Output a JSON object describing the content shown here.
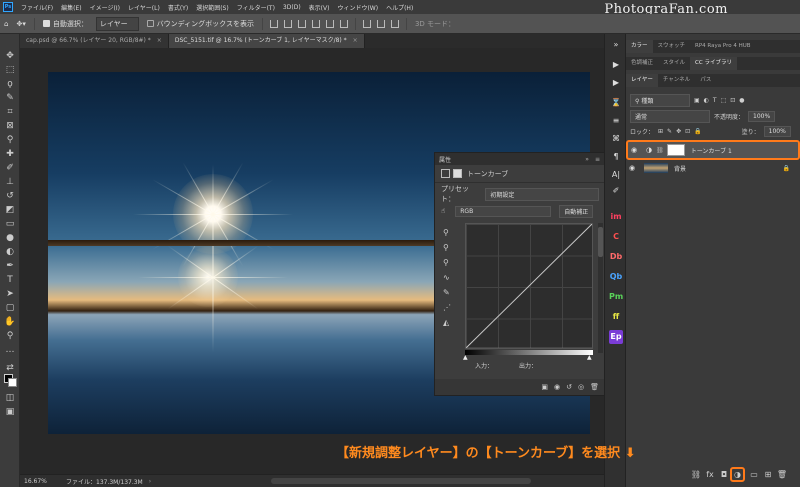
{
  "menubar": {
    "items": [
      "ファイル(F)",
      "編集(E)",
      "イメージ(I)",
      "レイヤー(L)",
      "書式(Y)",
      "選択範囲(S)",
      "フィルター(T)",
      "3D(D)",
      "表示(V)",
      "ウィンドウ(W)",
      "ヘルプ(H)"
    ],
    "logo_letters": "Ps"
  },
  "watermark": "PhotograFan.com",
  "options": {
    "auto_select_label": "自動選択：",
    "auto_select_value": "レイヤー",
    "bbox_label": "バウンディングボックスを表示",
    "mode_3d": "3D モード："
  },
  "tabs": [
    {
      "label": "cap.psd @ 66.7% (レイヤー 20, RGB/8#) *",
      "close": "×"
    },
    {
      "label": "DSC_5151.tif @ 16.7% (トーンカーブ 1, レイヤーマスク/8) *",
      "close": "×"
    }
  ],
  "status": {
    "zoom": "16.67%",
    "file": "ファイル：137.3M/137.3M"
  },
  "properties": {
    "title": "属性",
    "panel_name": "トーンカーブ",
    "preset_label": "プリセット：",
    "preset_value": "初期設定",
    "channel": "RGB",
    "auto_button": "自動補正",
    "input_label": "入力：",
    "output_label": "出力："
  },
  "panels": {
    "row1": [
      "カラー",
      "スウォッチ",
      "RP4 Raya Pro 4 HUB"
    ],
    "row2": [
      "色調補正",
      "スタイル",
      "CC ライブラリ"
    ],
    "row3": [
      "レイヤー",
      "チャンネル",
      "パス"
    ],
    "kind_filter": "種類",
    "blend_mode": "通常",
    "opacity_label": "不透明度：",
    "opacity_value": "100%",
    "lock_label": "ロック：",
    "fill_label": "塗り：",
    "fill_value": "100%"
  },
  "layers": [
    {
      "name": "トーンカーブ 1",
      "selected": true
    },
    {
      "name": "背景",
      "selected": false
    }
  ],
  "dock_ext": [
    "im",
    "C",
    "Db",
    "Qb",
    "Pm",
    "ff",
    "Ep"
  ],
  "caption": "【新規調整レイヤー】の【トーンカーブ】を選択 ⬇",
  "colors": {
    "accent": "#ff7a1a",
    "ps_blue": "#31a8ff"
  }
}
